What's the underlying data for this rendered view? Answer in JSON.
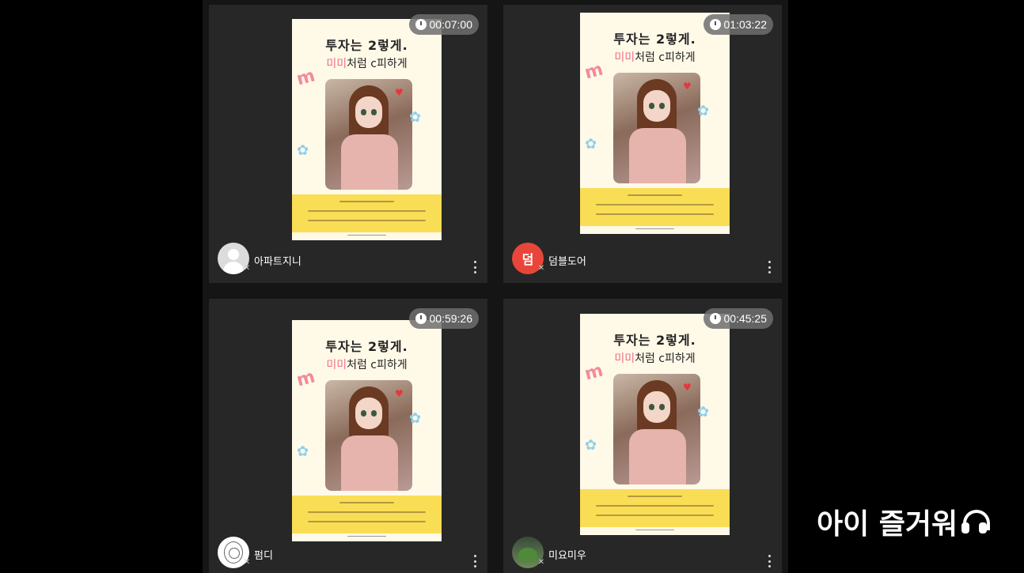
{
  "tiles": [
    {
      "id": "t1",
      "timer": "00:07:00",
      "username": "아파트지니",
      "avatar": "default-avatar"
    },
    {
      "id": "t2",
      "timer": "01:03:22",
      "username": "덤블도어",
      "avatar": "initial-avatar",
      "avatar_initial": "덤"
    },
    {
      "id": "t3",
      "timer": "00:59:26",
      "username": "펌디",
      "avatar": "sketch-avatar"
    },
    {
      "id": "t4",
      "timer": "00:45:25",
      "username": "미요미우",
      "avatar": "photo-avatar"
    }
  ],
  "poster": {
    "title": "투자는 2렇게.",
    "subtitle_a": "미미",
    "subtitle_b": "처럼 c피하게"
  },
  "caption": "아이 즐거워",
  "icons": {
    "timer": "clock-icon",
    "mic": "mic-off-icon",
    "menu": "more-vertical-icon",
    "caption": "headphones-icon"
  },
  "colors": {
    "tile_bg": "#272727",
    "timer_bg": "#6e6e6e",
    "initial_avatar_bg": "#e8463a",
    "poster_band": "#f9dd55"
  }
}
